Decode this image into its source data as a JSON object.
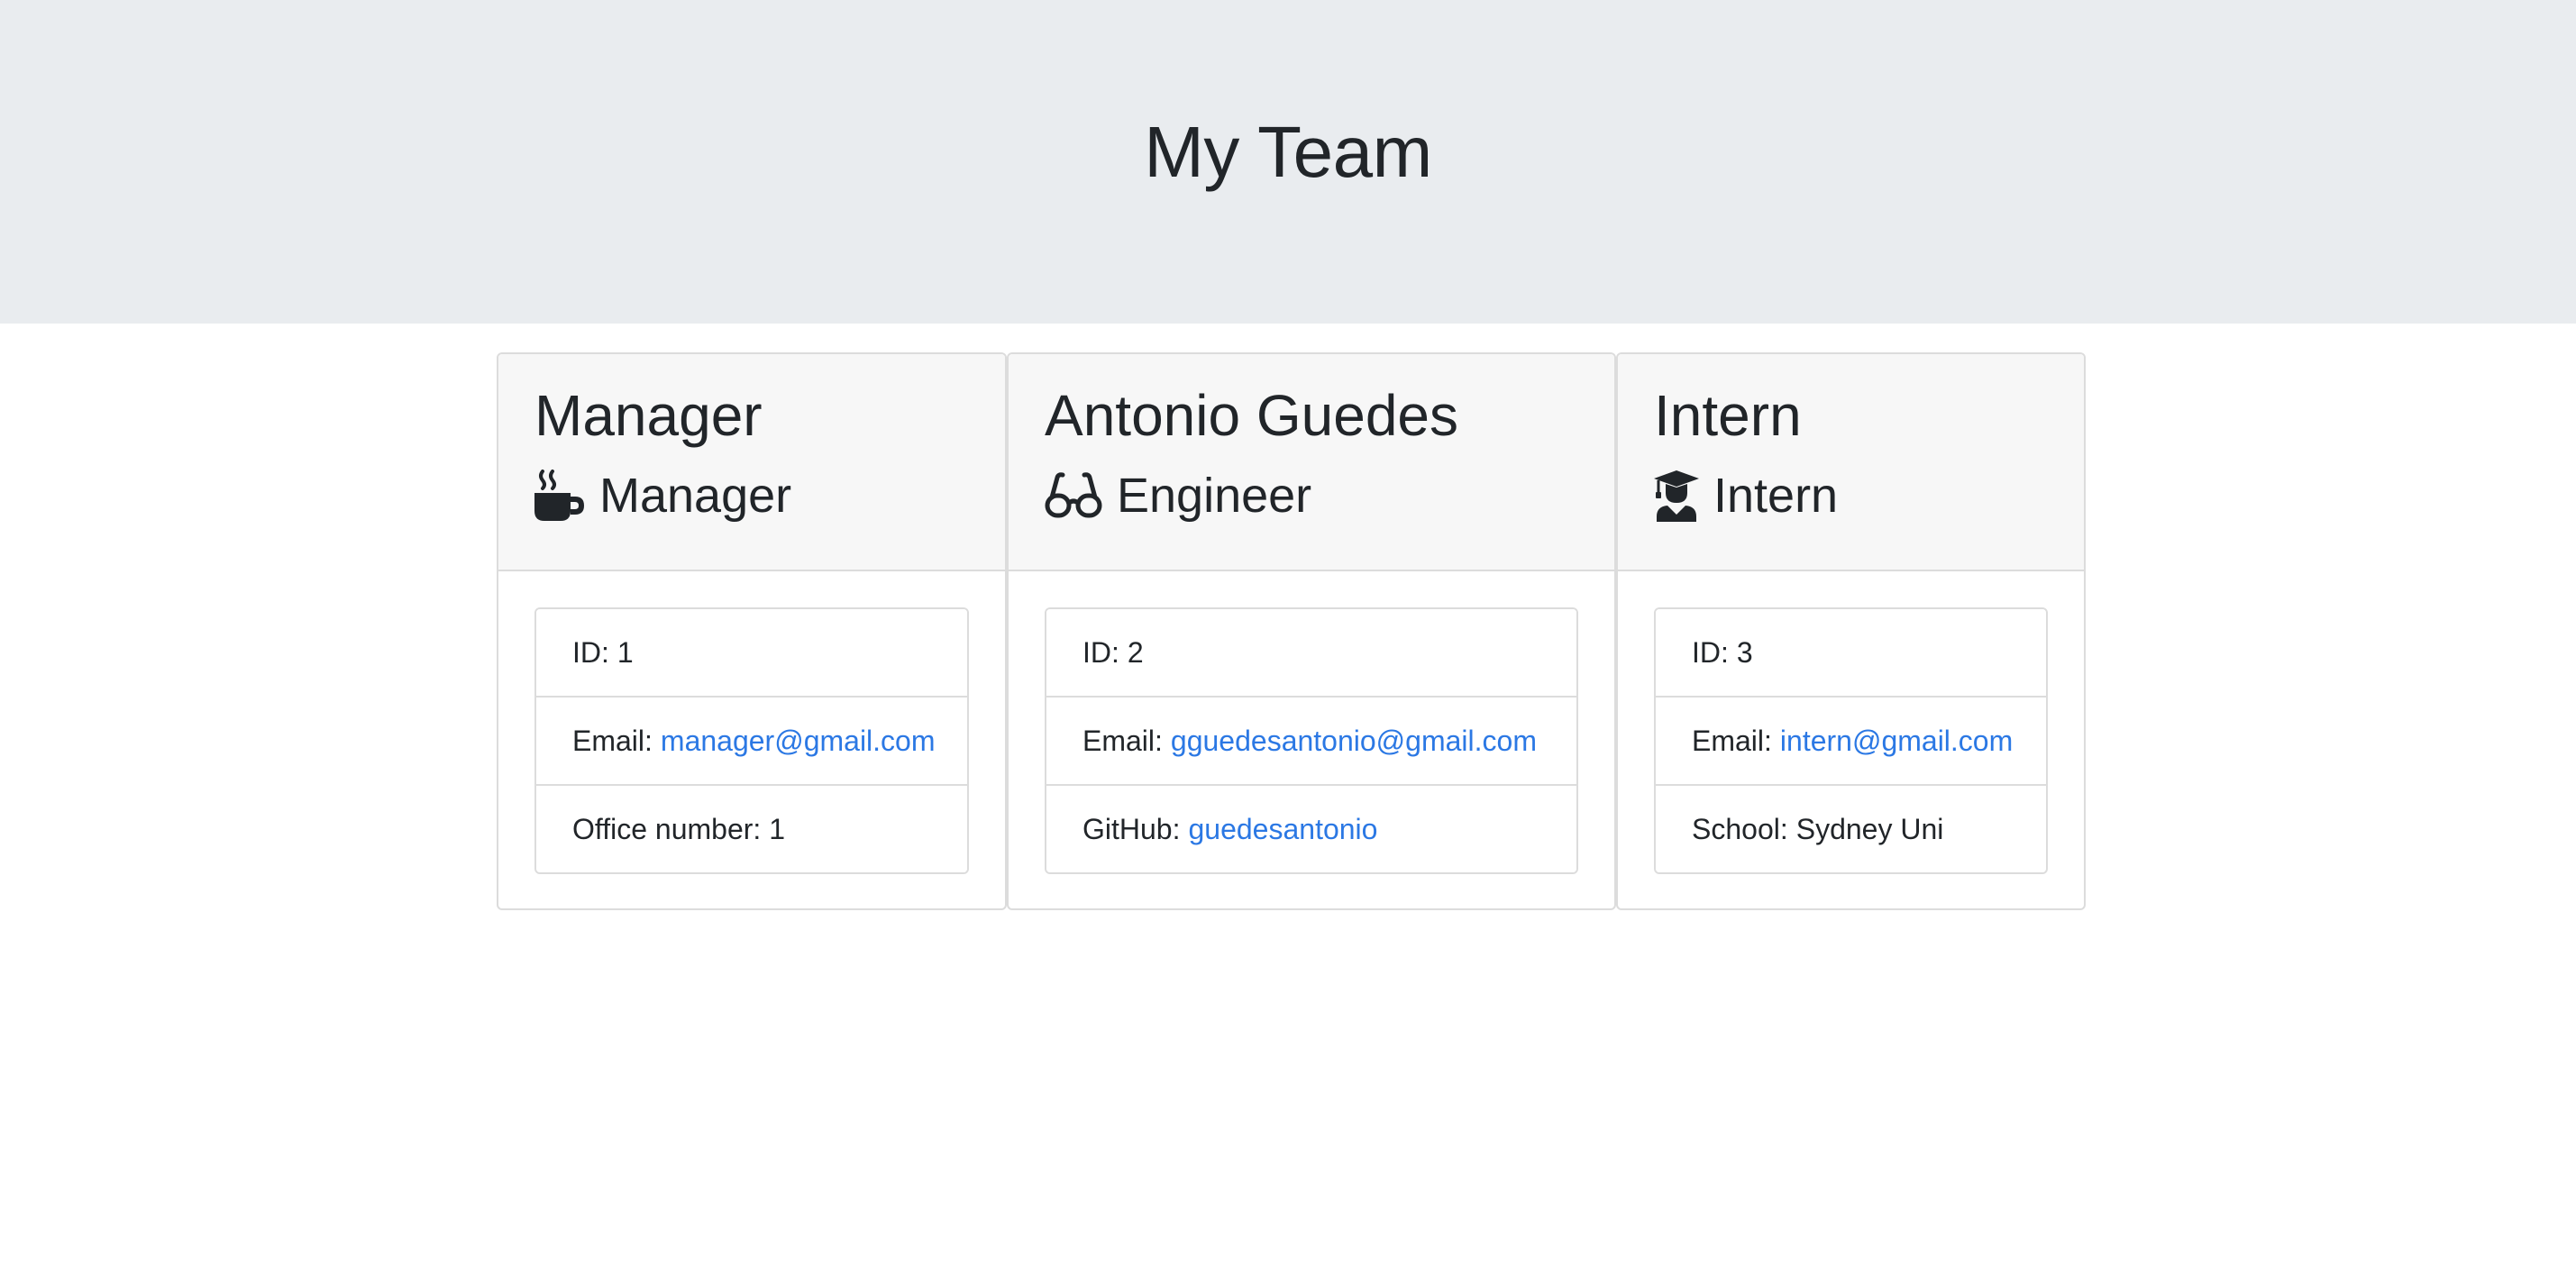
{
  "header": {
    "title": "My Team"
  },
  "colors": {
    "jumbotron_bg": "#e9ecef",
    "card_header_bg": "#f7f7f7",
    "link": "#2b78e4",
    "text": "#212529"
  },
  "cards": [
    {
      "name": "Manager",
      "role": "Manager",
      "icon": "coffee-icon",
      "id_label": "ID:",
      "id_value": "1",
      "email_label": "Email:",
      "email_value": "manager@gmail.com",
      "extra_label": "Office number:",
      "extra_value": "1"
    },
    {
      "name": "Antonio Guedes",
      "role": "Engineer",
      "icon": "glasses-icon",
      "id_label": "ID:",
      "id_value": "2",
      "email_label": "Email:",
      "email_value": "gguedesantonio@gmail.com",
      "extra_label": "GitHub:",
      "extra_value": "guedesantonio"
    },
    {
      "name": "Intern",
      "role": "Intern",
      "icon": "graduate-icon",
      "id_label": "ID:",
      "id_value": "3",
      "email_label": "Email:",
      "email_value": "intern@gmail.com",
      "extra_label": "School:",
      "extra_value": "Sydney Uni"
    }
  ]
}
